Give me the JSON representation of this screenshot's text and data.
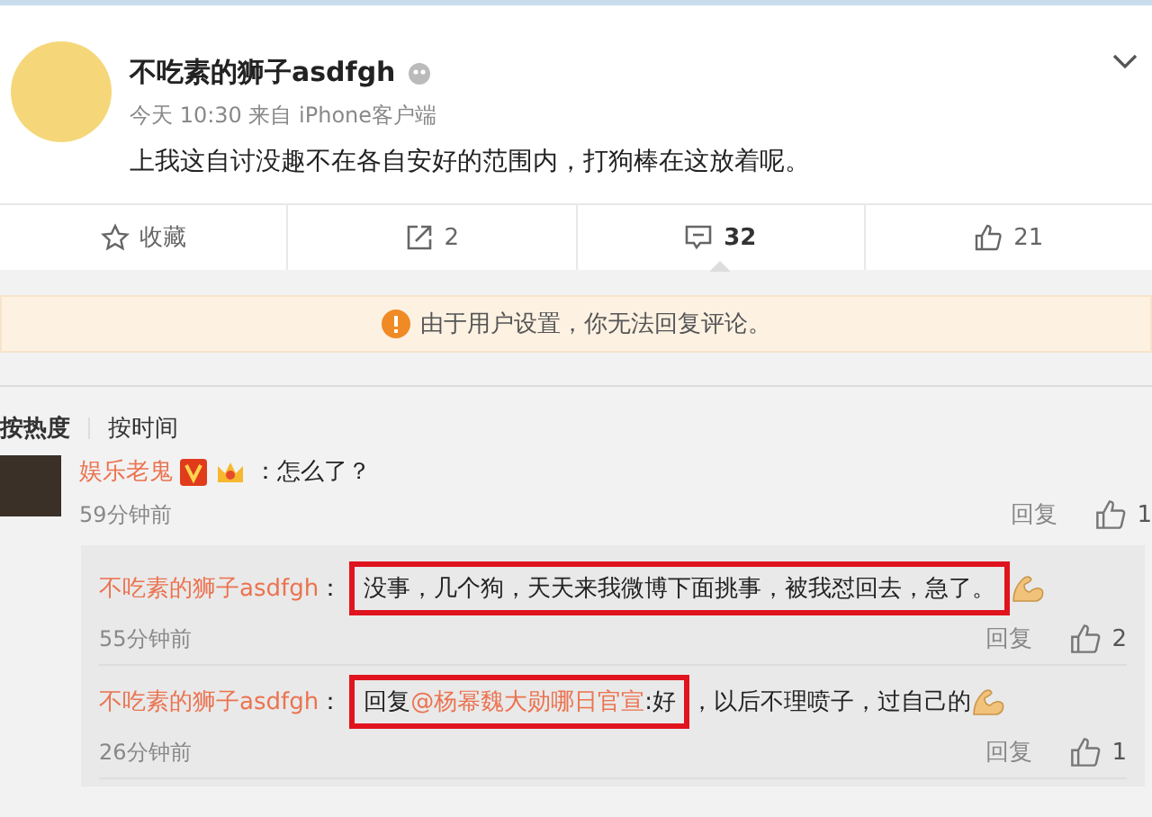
{
  "post": {
    "author": "不吃素的狮子asdfgh",
    "meta": "今天 10:30 来自 iPhone客户端",
    "text": "上我这自讨没趣不在各自安好的范围内，打狗棒在这放着呢。"
  },
  "actions": [
    {
      "kind": "favorite",
      "label": "收藏",
      "selected": false
    },
    {
      "kind": "repost",
      "label": "2",
      "selected": false
    },
    {
      "kind": "comment",
      "label": "32",
      "selected": true
    },
    {
      "kind": "like",
      "label": "21",
      "selected": false
    }
  ],
  "notice": "由于用户设置，你无法回复评论。",
  "sort_tabs": [
    {
      "label": "按热度",
      "selected": true
    },
    {
      "label": "按时间",
      "selected": false
    }
  ],
  "comment": {
    "author": "娱乐老鬼",
    "text": "：怎么了？",
    "time": "59分钟前",
    "reply": "回复",
    "likes": "1"
  },
  "replies": [
    {
      "author": "不吃素的狮子asdfgh",
      "colon": "：",
      "segments": [
        {
          "kind": "text",
          "text": "没事，几个狗，天天来我微博下面挑事，被我怼回去，急了。",
          "highlighted": true
        }
      ],
      "time": "55分钟前",
      "reply": "回复",
      "likes": "2"
    },
    {
      "author": "不吃素的狮子asdfgh",
      "colon": "：",
      "segments": [
        {
          "kind": "text",
          "text": "回复",
          "highlighted": true
        },
        {
          "kind": "mention",
          "text": "@杨幂魏大勋哪日官宣",
          "highlighted": true
        },
        {
          "kind": "text",
          "text": ":好",
          "highlighted": true
        },
        {
          "kind": "text",
          "text": "，以后不理喷子，过自己的",
          "highlighted": false
        }
      ],
      "time": "26分钟前",
      "reply": "回复",
      "likes": "1"
    }
  ]
}
